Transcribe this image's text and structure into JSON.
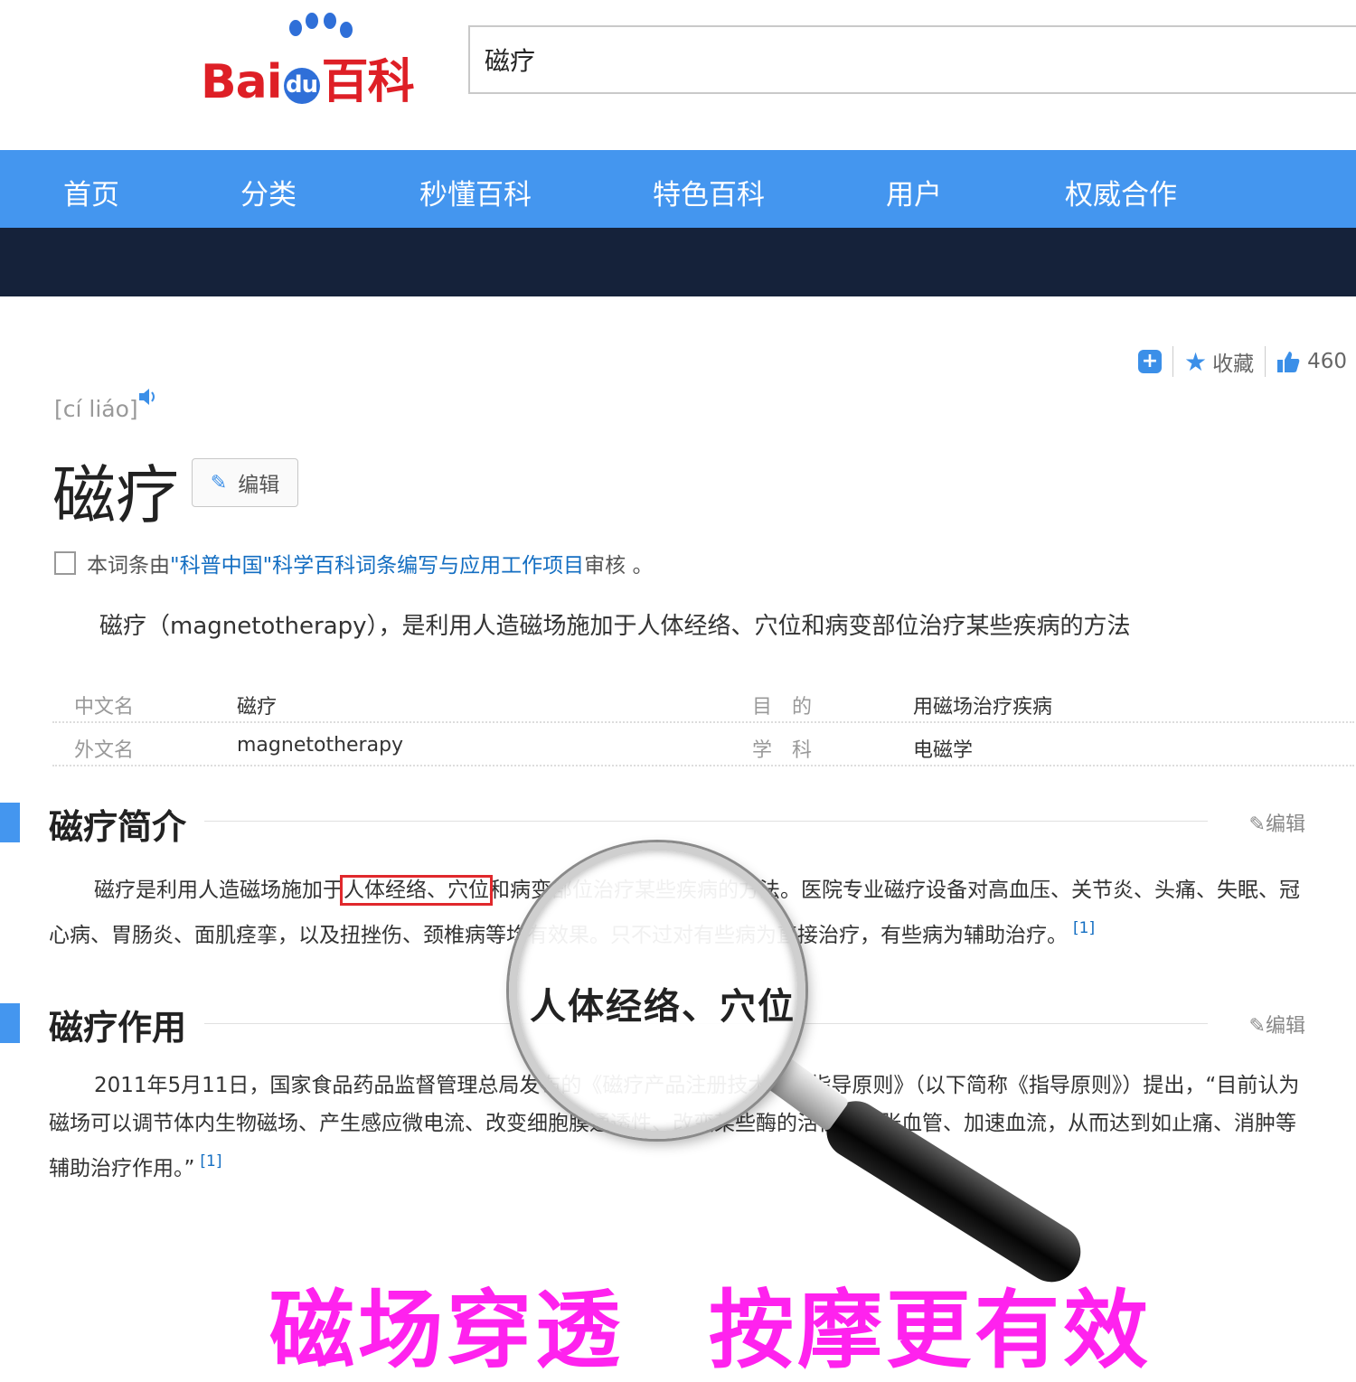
{
  "logo": {
    "text_left": "Bai",
    "text_du": "du",
    "text_right": "百科"
  },
  "search": {
    "value": "磁疗"
  },
  "nav": {
    "items": [
      "首页",
      "分类",
      "秒懂百科",
      "特色百科",
      "用户",
      "权威合作"
    ]
  },
  "toolbar": {
    "plus": "+",
    "collect_label": "收藏",
    "like_count": "460"
  },
  "entry": {
    "pinyin": "[cí liáo]",
    "title": "磁疗",
    "edit_label": "编辑",
    "review_prefix": "本词条由",
    "review_link": "\"科普中国\"科学百科词条编写与应用工作项目",
    "review_suffix": " 审核 。",
    "summary": "磁疗（magnetotherapy），是利用人造磁场施加于人体经络、穴位和病变部位治疗某些疾病的方法"
  },
  "basic_info": [
    {
      "label1": "中文名",
      "value1": "磁疗",
      "label2": "目　的",
      "value2": "用磁场治疗疾病"
    },
    {
      "label1": "外文名",
      "value1": "magnetotherapy",
      "label2": "学　科",
      "value2": "电磁学"
    }
  ],
  "sections": [
    {
      "title": "磁疗简介",
      "edit_label": "编辑",
      "text_before": "磁疗是利用人造磁场施加于",
      "highlight": "人体经络、穴位",
      "text_after": "和病变部位治疗某些疾病的方法。医院专业磁疗设备对高血压、关节炎、头痛、失眠、冠心病、胃肠炎、面肌痉挛，以及扭挫伤、颈椎病等均有效果。只不过对有些病为直接治疗，有些病为辅助治疗。",
      "ref": "[1]"
    },
    {
      "title": "磁疗作用",
      "edit_label": "编辑",
      "text": "2011年5月11日，国家食品药品监督管理总局发布的《磁疗产品注册技术审查指导原则》（以下简称《指导原则》）提出，“目前认为磁场可以调节体内生物磁场、产生感应微电流、改变细胞膜通透性、改变某些酶的活性和扩张血管、加速血流，从而达到如止痛、消肿等辅助治疗作用。”",
      "ref": "[1]"
    }
  ],
  "magnifier": {
    "text": "人体经络、穴位"
  },
  "slogan": {
    "left": "磁场穿透",
    "right": "按摩更有效"
  },
  "colors": {
    "nav_blue": "#4496ef",
    "dark_band": "#15223a",
    "logo_red": "#de1f26",
    "logo_blue": "#2f6fd8",
    "link_blue": "#136ec2",
    "slogan_magenta": "#ff22ee",
    "highlight_red": "#e0282c"
  }
}
